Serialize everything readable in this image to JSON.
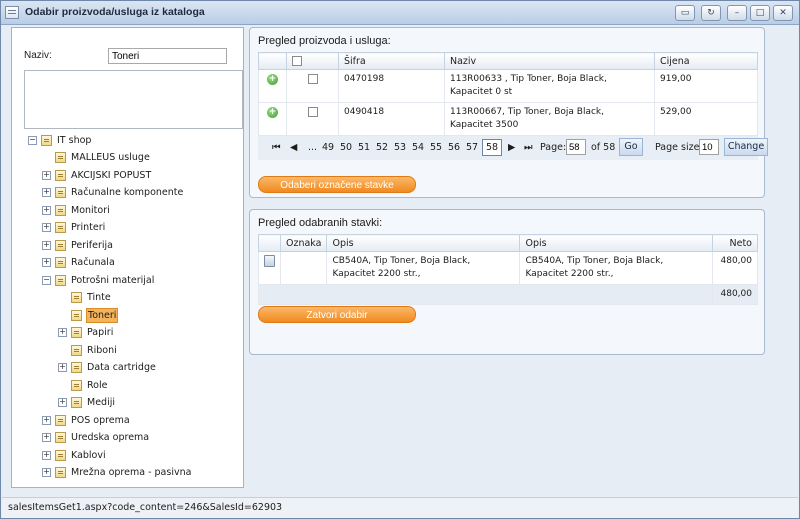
{
  "window": {
    "title": "Odabir proizvoda/usluga iz kataloga"
  },
  "filter": {
    "label": "Naziv:",
    "value": "Toneri"
  },
  "tree": {
    "root": "IT shop",
    "items": [
      {
        "label": "MALLEUS usluge"
      },
      {
        "label": "AKCIJSKI POPUST"
      },
      {
        "label": "Računalne komponente"
      },
      {
        "label": "Monitori"
      },
      {
        "label": "Printeri"
      },
      {
        "label": "Periferija"
      },
      {
        "label": "Računala"
      },
      {
        "label": "Potrošni materijal"
      },
      {
        "label": "Tinte"
      },
      {
        "label": "Toneri"
      },
      {
        "label": "Papiri"
      },
      {
        "label": "Riboni"
      },
      {
        "label": "Data cartridge"
      },
      {
        "label": "Role"
      },
      {
        "label": "Mediji"
      },
      {
        "label": "POS oprema"
      },
      {
        "label": "Uredska oprema"
      },
      {
        "label": "Kablovi"
      },
      {
        "label": "Mrežna oprema - pasivna"
      }
    ]
  },
  "products": {
    "title": "Pregled proizvoda i usluga:",
    "columns": [
      "Šifra",
      "Naziv",
      "Cijena"
    ],
    "rows": [
      {
        "sifra": "0470198",
        "naziv": "113R00633 , Tip Toner, Boja Black, Kapacitet 0 st",
        "cijena": "919,00"
      },
      {
        "sifra": "0490418",
        "naziv": "113R00667, Tip Toner, Boja Black, Kapacitet 3500",
        "cijena": "529,00"
      }
    ],
    "pager": {
      "pages": [
        "...",
        "49",
        "50",
        "51",
        "52",
        "53",
        "54",
        "55",
        "56",
        "57",
        "58"
      ],
      "current": "58",
      "page_label": "Page:",
      "page_value": "58",
      "of_label": "of 58",
      "go_label": "Go",
      "page_size_label": "Page size:",
      "page_size_value": "10",
      "change_label": "Change"
    },
    "select_button": "Odaberi označene stavke"
  },
  "selected": {
    "title": "Pregled odabranih stavki:",
    "columns": [
      "Oznaka",
      "Opis",
      "Opis",
      "Neto"
    ],
    "rows": [
      {
        "opis1": "CB540A, Tip Toner, Boja Black, Kapacitet 2200 str.,",
        "opis2": "CB540A, Tip Toner, Boja Black, Kapacitet 2200 str.,",
        "neto": "480,00"
      }
    ],
    "total": "480,00",
    "close_button": "Zatvori odabir"
  },
  "status": {
    "url": "salesItemsGet1.aspx?code_content=246&SalesId=62903"
  }
}
